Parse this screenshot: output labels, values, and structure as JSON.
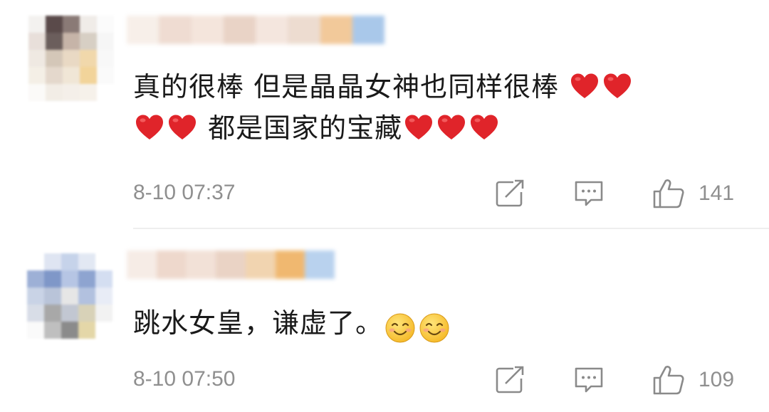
{
  "comments": [
    {
      "text_line1": "真的很棒 但是晶晶女神也同样很棒",
      "text_line2": "都是国家的宝藏",
      "time": "8-10 07:37",
      "likes": "141",
      "emoji_trailing_line1": "heart",
      "emoji_count_line1_end": 2,
      "emoji_line2_start": "heart",
      "emoji_line2_start_count": 2,
      "emoji_line2_end": "heart",
      "emoji_line2_end_count": 3
    },
    {
      "text": "跳水女皇，谦虚了。",
      "time": "8-10 07:50",
      "likes": "109",
      "emoji_trailing": "smiling-face",
      "emoji_trailing_count": 2
    }
  ],
  "icons": {
    "repost": "share-icon",
    "reply": "comment-icon",
    "like": "thumbs-up-icon"
  },
  "colors": {
    "text": "#1a1a1a",
    "meta": "#8f8f8f",
    "heart": "#e0242a",
    "divider": "#eeeeee"
  }
}
